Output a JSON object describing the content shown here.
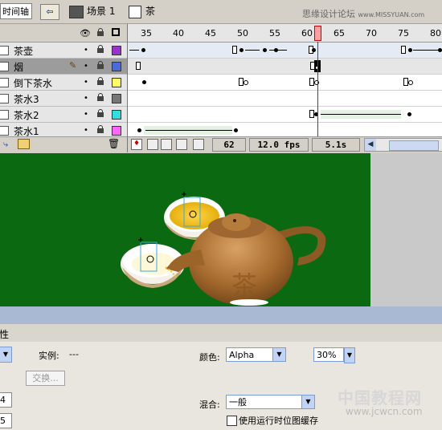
{
  "top_bar": {
    "timeline_button": "时间轴",
    "scene_label": "场景 1",
    "symbol_label": "茶",
    "watermark": "思缘设计论坛",
    "watermark_url": "www.MISSYUAN.com"
  },
  "timeline": {
    "ruler": [
      "35",
      "40",
      "45",
      "50",
      "55",
      "60",
      "65",
      "70",
      "75",
      "80"
    ],
    "layers": [
      {
        "name": "茶壶",
        "color": "#9933cc",
        "selected": false
      },
      {
        "name": "烟",
        "color": "#4a6bd9",
        "selected": true
      },
      {
        "name": "倒下茶水",
        "color": "#ffff66",
        "selected": false
      },
      {
        "name": "茶水3",
        "color": "#777777",
        "selected": false
      },
      {
        "name": "茶水2",
        "color": "#33dddd",
        "selected": false
      },
      {
        "name": "茶水1",
        "color": "#ff66ff",
        "selected": false
      }
    ],
    "status": {
      "current_frame": "62",
      "fps": "12.0 fps",
      "elapsed": "5.1s"
    }
  },
  "stage": {
    "teapot_text": "茶",
    "background": "#0b6a11"
  },
  "properties": {
    "header": "属性",
    "instance_label": "实例:",
    "instance_value": "---",
    "swap_button": "交换...",
    "color_label": "颜色:",
    "color_value": "Alpha",
    "alpha_value": "30%",
    "blend_label": "混合:",
    "blend_value": "一般",
    "cache_label": "使用运行时位图缓存",
    "left_values": [
      "4",
      "5"
    ]
  },
  "watermark_bottom": {
    "main": "中国教程网",
    "url": "www.jcwcn.com"
  }
}
